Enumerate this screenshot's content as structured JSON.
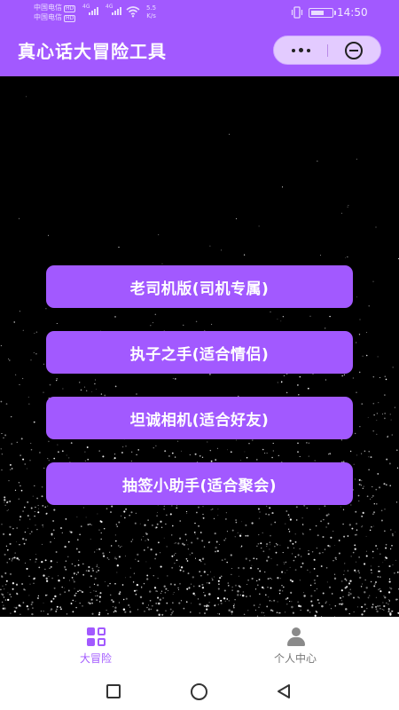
{
  "status_bar": {
    "carrier_1": "中国电信",
    "carrier_2": "中国电信",
    "hd_badge": "HD",
    "network_1": "4G",
    "network_2": "4G",
    "speed_value": "5.5",
    "speed_unit": "K/s",
    "time": "14:50"
  },
  "header": {
    "title": "真心话大冒险工具"
  },
  "menu": {
    "buttons": [
      {
        "label": "老司机版(司机专属)"
      },
      {
        "label": "执子之手(适合情侣)"
      },
      {
        "label": "坦诚相机(适合好友)"
      },
      {
        "label": "抽签小助手(适合聚会)"
      }
    ]
  },
  "tabbar": {
    "tabs": [
      {
        "label": "大冒险",
        "active": true
      },
      {
        "label": "个人中心",
        "active": false
      }
    ]
  },
  "colors": {
    "accent": "#a259ff",
    "background": "#000000",
    "tab_inactive": "#777777"
  }
}
